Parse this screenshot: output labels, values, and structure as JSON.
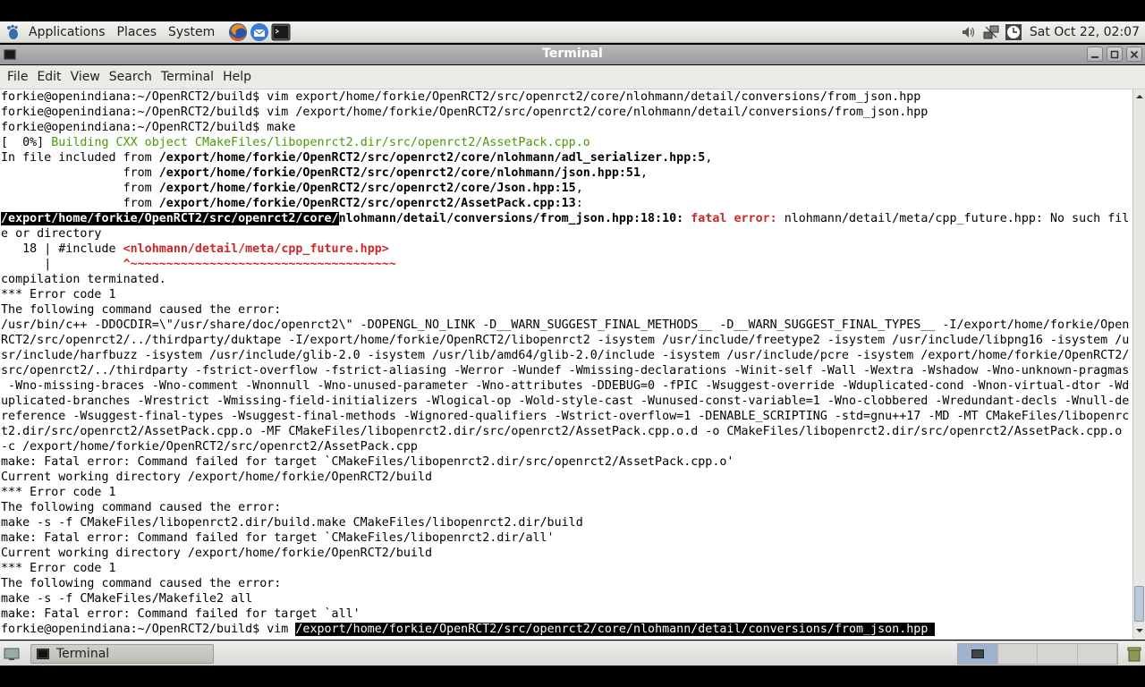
{
  "top_panel": {
    "menus": [
      "Applications",
      "Places",
      "System"
    ],
    "launchers": [
      "firefox-icon",
      "thunderbird-icon",
      "terminal-launcher-icon"
    ],
    "tray_icons": [
      "volume-icon",
      "network-icon",
      "clock-icon"
    ],
    "clock": "Sat Oct 22, 02:07"
  },
  "window": {
    "title": "Terminal",
    "buttons": [
      "minimize-icon",
      "maximize-icon",
      "close-icon"
    ]
  },
  "menubar": [
    "File",
    "Edit",
    "View",
    "Search",
    "Terminal",
    "Help"
  ],
  "terminal": {
    "lines": [
      [
        {
          "t": "forkie@openindiana:~/OpenRCT2/build$ vim export/home/forkie/OpenRCT2/src/openrct2/core/nlohmann/detail/conversions/from_json.hpp"
        }
      ],
      [
        {
          "t": "forkie@openindiana:~/OpenRCT2/build$ vim /export/home/forkie/OpenRCT2/src/openrct2/core/nlohmann/detail/conversions/from_json.hpp"
        }
      ],
      [
        {
          "t": "forkie@openindiana:~/OpenRCT2/build$ make"
        }
      ],
      [
        {
          "t": "[  0%] "
        },
        {
          "t": "Building CXX object CMakeFiles/libopenrct2.dir/src/openrct2/AssetPack.cpp.o",
          "s": "grn"
        }
      ],
      [
        {
          "t": "In file included from "
        },
        {
          "t": "/export/home/forkie/OpenRCT2/src/openrct2/core/nlohmann/adl_serializer.hpp:5",
          "s": "b"
        },
        {
          "t": ","
        }
      ],
      [
        {
          "t": "                 from "
        },
        {
          "t": "/export/home/forkie/OpenRCT2/src/openrct2/core/nlohmann/json.hpp:51",
          "s": "b"
        },
        {
          "t": ","
        }
      ],
      [
        {
          "t": "                 from "
        },
        {
          "t": "/export/home/forkie/OpenRCT2/src/openrct2/core/Json.hpp:15",
          "s": "b"
        },
        {
          "t": ","
        }
      ],
      [
        {
          "t": "                 from "
        },
        {
          "t": "/export/home/forkie/OpenRCT2/src/openrct2/AssetPack.cpp:13",
          "s": "b"
        },
        {
          "t": ":"
        }
      ],
      [
        {
          "t": "/export/home/forkie/OpenRCT2/src/openrct2/core/",
          "s": "sel b"
        },
        {
          "t": "nlohmann/detail/conversions/from_json.hpp:18:10:",
          "s": "b"
        },
        {
          "t": " "
        },
        {
          "t": "fatal error:",
          "s": "red"
        },
        {
          "t": " nlohmann/detail/meta/cpp_future.hpp: No such fil"
        }
      ],
      [
        {
          "t": "e or directory"
        }
      ],
      [
        {
          "t": "   18 | #include "
        },
        {
          "t": "<nlohmann/detail/meta/cpp_future.hpp>",
          "s": "red"
        }
      ],
      [
        {
          "t": "      |          "
        },
        {
          "t": "^~~~~~~~~~~~~~~~~~~~~~~~~~~~~~~~~~~~~~",
          "s": "red"
        }
      ],
      [
        {
          "t": "compilation terminated."
        }
      ],
      [
        {
          "t": "*** Error code 1"
        }
      ],
      [
        {
          "t": "The following command caused the error:"
        }
      ],
      [
        {
          "t": "/usr/bin/c++ -DDOCDIR=\\\"/usr/share/doc/openrct2\\\" -DOPENGL_NO_LINK -D__WARN_SUGGEST_FINAL_METHODS__ -D__WARN_SUGGEST_FINAL_TYPES__ -I/export/home/forkie/Open"
        }
      ],
      [
        {
          "t": "RCT2/src/openrct2/../thirdparty/duktape -I/export/home/forkie/OpenRCT2/libopenrct2 -isystem /usr/include/freetype2 -isystem /usr/include/libpng16 -isystem /u"
        }
      ],
      [
        {
          "t": "sr/include/harfbuzz -isystem /usr/include/glib-2.0 -isystem /usr/lib/amd64/glib-2.0/include -isystem /usr/include/pcre -isystem /export/home/forkie/OpenRCT2/"
        }
      ],
      [
        {
          "t": "src/openrct2/../thirdparty -fstrict-overflow -fstrict-aliasing -Werror -Wundef -Wmissing-declarations -Winit-self -Wall -Wextra -Wshadow -Wno-unknown-pragmas"
        }
      ],
      [
        {
          "t": " -Wno-missing-braces -Wno-comment -Wnonnull -Wno-unused-parameter -Wno-attributes -DDEBUG=0 -fPIC -Wsuggest-override -Wduplicated-cond -Wnon-virtual-dtor -Wd"
        }
      ],
      [
        {
          "t": "uplicated-branches -Wrestrict -Wmissing-field-initializers -Wlogical-op -Wold-style-cast -Wunused-const-variable=1 -Wno-clobbered -Wredundant-decls -Wnull-de"
        }
      ],
      [
        {
          "t": "reference -Wsuggest-final-types -Wsuggest-final-methods -Wignored-qualifiers -Wstrict-overflow=1 -DENABLE_SCRIPTING -std=gnu++17 -MD -MT CMakeFiles/libopenrc"
        }
      ],
      [
        {
          "t": "t2.dir/src/openrct2/AssetPack.cpp.o -MF CMakeFiles/libopenrct2.dir/src/openrct2/AssetPack.cpp.o.d -o CMakeFiles/libopenrct2.dir/src/openrct2/AssetPack.cpp.o"
        }
      ],
      [
        {
          "t": "-c /export/home/forkie/OpenRCT2/src/openrct2/AssetPack.cpp"
        }
      ],
      [
        {
          "t": "make: Fatal error: Command failed for target `CMakeFiles/libopenrct2.dir/src/openrct2/AssetPack.cpp.o'"
        }
      ],
      [
        {
          "t": "Current working directory /export/home/forkie/OpenRCT2/build"
        }
      ],
      [
        {
          "t": "*** Error code 1"
        }
      ],
      [
        {
          "t": "The following command caused the error:"
        }
      ],
      [
        {
          "t": "make -s -f CMakeFiles/libopenrct2.dir/build.make CMakeFiles/libopenrct2.dir/build"
        }
      ],
      [
        {
          "t": "make: Fatal error: Command failed for target `CMakeFiles/libopenrct2.dir/all'"
        }
      ],
      [
        {
          "t": "Current working directory /export/home/forkie/OpenRCT2/build"
        }
      ],
      [
        {
          "t": "*** Error code 1"
        }
      ],
      [
        {
          "t": "The following command caused the error:"
        }
      ],
      [
        {
          "t": "make -s -f CMakeFiles/Makefile2 all"
        }
      ],
      [
        {
          "t": "make: Fatal error: Command failed for target `all'"
        }
      ],
      [
        {
          "t": "forkie@openindiana:~/OpenRCT2/build$ vim "
        },
        {
          "t": "/export/home/forkie/OpenRCT2/src/openrct2/core/nlohmann/detail/conversions/from_json.hpp ",
          "s": "sel"
        }
      ]
    ]
  },
  "taskbar": {
    "task_label": "Terminal",
    "workspaces": 4,
    "active_workspace": 1
  },
  "colors": {
    "error_red": "#cd2828",
    "build_green": "#4a9a06",
    "terminal_bg": "#ffffff",
    "titlebar": "#a8a9ac"
  }
}
